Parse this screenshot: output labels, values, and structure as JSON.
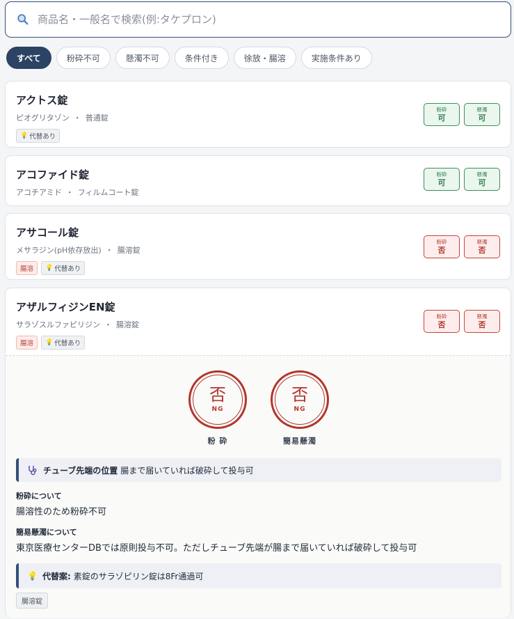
{
  "search": {
    "placeholder": "商品名・一般名で検索(例:タケプロン)"
  },
  "filters": [
    "すべて",
    "粉砕不可",
    "懸濁不可",
    "条件付き",
    "徐放・腸溶",
    "実施条件あり"
  ],
  "badge_labels": {
    "crush": "粉砕",
    "suspend": "懸濁"
  },
  "drugs": [
    {
      "name": "アクトス錠",
      "generic": "ピオグリタゾン",
      "form": "普通錠",
      "tags": [
        "代替あり"
      ],
      "crush": "可",
      "suspend": "可"
    },
    {
      "name": "アコファイド錠",
      "generic": "アコチアミド",
      "form": "フィルムコート錠",
      "tags": [],
      "crush": "可",
      "suspend": "可"
    },
    {
      "name": "アサコール錠",
      "generic": "メサラジン(pH依存放出)",
      "form": "腸溶錠",
      "tags": [
        "腸溶",
        "代替あり"
      ],
      "crush": "否",
      "suspend": "否"
    },
    {
      "name": "アザルフィジンEN錠",
      "generic": "サラゾスルファピリジン",
      "form": "腸溶錠",
      "tags": [
        "腸溶",
        "代替あり"
      ],
      "crush": "否",
      "suspend": "否"
    }
  ],
  "detail": {
    "stamps": [
      {
        "kanji": "否",
        "code": "NG",
        "label": "粉 砕"
      },
      {
        "kanji": "否",
        "code": "NG",
        "label": "簡易懸濁"
      }
    ],
    "tube_title": "チューブ先端の位置",
    "tube_text": "腸まで届いていれば破砕して投与可",
    "crush_heading": "粉砕について",
    "crush_text": "腸溶性のため粉砕不可",
    "suspend_heading": "簡易懸濁について",
    "suspend_text": "東京医療センターDBでは原則投与不可。ただしチューブ先端が腸まで届いていれば破砕して投与可",
    "alt_title": "代替案:",
    "alt_text": "素錠のサラゾピリン錠は8Fr通過可",
    "form_tag": "腸溶錠"
  },
  "colors": {
    "primary": "#2d4363",
    "ok": "#2e7d4a",
    "ng": "#b33a31",
    "bulb": "#e8b21a"
  },
  "icons": {
    "search": "search-icon",
    "stethoscope": "stethoscope-icon",
    "bulb": "lightbulb-icon"
  }
}
